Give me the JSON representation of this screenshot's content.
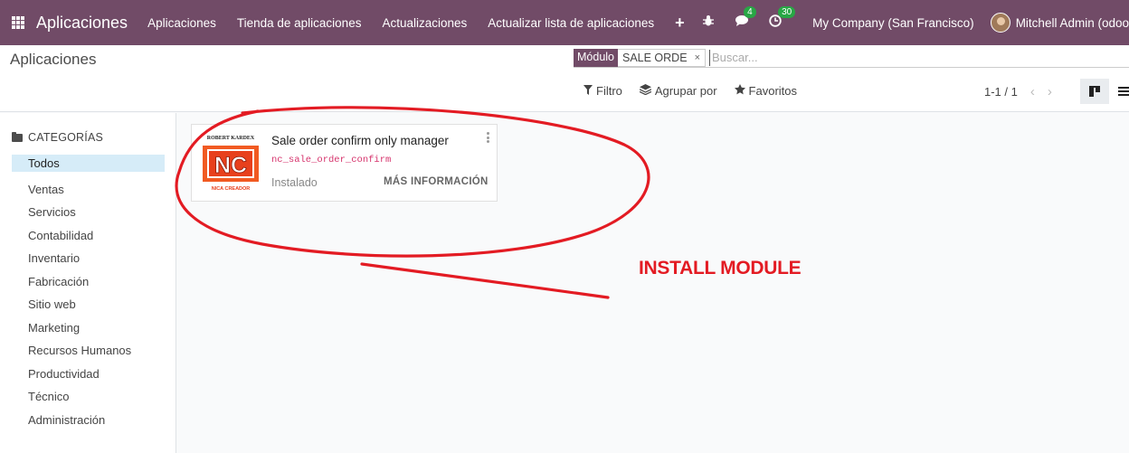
{
  "navbar": {
    "brand": "Aplicaciones",
    "menu": [
      "Aplicaciones",
      "Tienda de aplicaciones",
      "Actualizaciones",
      "Actualizar lista de aplicaciones"
    ],
    "plus_icon": "plus-icon",
    "debug_icon": "bug-icon",
    "messages_icon": "chat-icon",
    "messages_count": "4",
    "activities_icon": "clock-icon",
    "activities_count": "30",
    "company": "My Company (San Francisco)",
    "user": "Mitchell Admin (odoo"
  },
  "control_panel": {
    "breadcrumb": "Aplicaciones",
    "facet_label": "Módulo",
    "facet_value": "SALE ORDE",
    "facet_remove": "×",
    "search_placeholder": "Buscar...",
    "filter_label": "Filtro",
    "group_label": "Agrupar por",
    "favorites_label": "Favoritos",
    "pager": "1-1 / 1",
    "prev": "‹",
    "next": "›"
  },
  "sidebar": {
    "header": "CATEGORÍAS",
    "items": [
      "Todos",
      "Ventas",
      "Servicios",
      "Contabilidad",
      "Inventario",
      "Fabricación",
      "Sitio web",
      "Marketing",
      "Recursos Humanos",
      "Productividad",
      "Técnico",
      "Administración"
    ],
    "active_index": 0
  },
  "card": {
    "title": "Sale order confirm only manager",
    "technical_name": "nc_sale_order_confirm",
    "status": "Instalado",
    "more_info": "MÁS INFORMACIÓN",
    "logo_top": "ROBERT KARDEX",
    "logo_letters": "NC",
    "logo_bottom": "NICA CREADOR"
  },
  "annotation": {
    "label": "INSTALL MODULE",
    "color": "#e31b23"
  },
  "colors": {
    "brand": "#714b67",
    "badge": "#28a745",
    "active_category": "#d6ecf8"
  }
}
